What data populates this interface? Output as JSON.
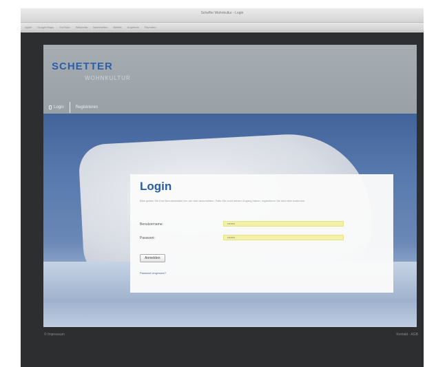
{
  "browser": {
    "title": "Scheffer Wohnkultur - Login",
    "bookmarks": [
      "Apple",
      "Google Maps",
      "YouTube",
      "Wikipedia",
      "Nachrichten",
      "Beliebt",
      "Angebote",
      "Favoriten"
    ]
  },
  "header": {
    "logo_top": "SCHETTER",
    "logo_bottom": "WOHNKULTUR",
    "nav": {
      "login": "Login",
      "register": "Registrieren"
    }
  },
  "login": {
    "title": "Login",
    "intro": "Bitte geben Sie Ihre Benutzerdaten ein, um sich anzumelden. Falls Sie noch keinen Zugang haben, registrieren Sie sich bitte kostenlos.",
    "username_label": "Benutzername:",
    "username_value": "••••••••",
    "password_label": "Passwort:",
    "password_value": "••••••••",
    "submit_label": "Anmelden",
    "forgot_link": "Passwort vergessen?"
  },
  "footer": {
    "left": "© Impressum",
    "right": "Kontakt · AGB"
  },
  "colors": {
    "accent": "#2a5ca6",
    "input_autofill": "#f3f2a4",
    "header_bg": "#a6adb2",
    "page_bg": "#2d2e30"
  }
}
